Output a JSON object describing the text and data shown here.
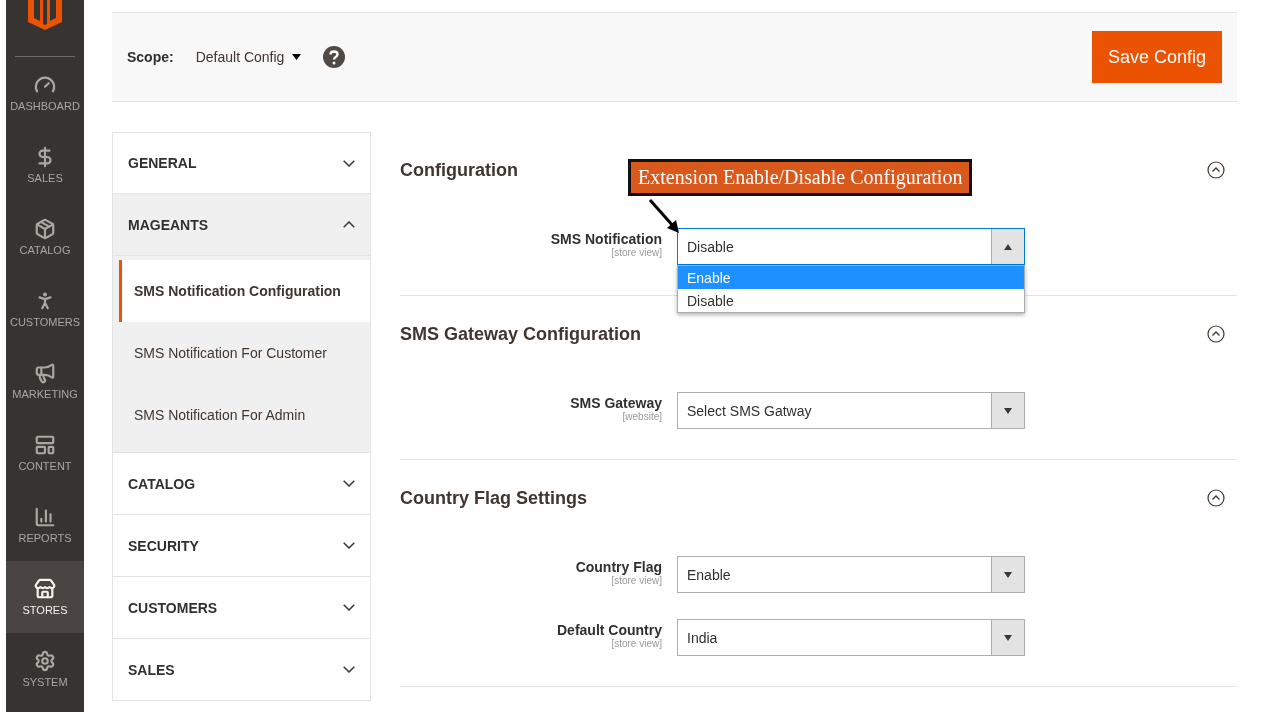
{
  "sidebar": {
    "items": [
      {
        "kind": "dashboard",
        "label": "DASHBOARD",
        "selected": false
      },
      {
        "kind": "sales",
        "label": "SALES",
        "selected": false
      },
      {
        "kind": "catalog",
        "label": "CATALOG",
        "selected": false
      },
      {
        "kind": "customers",
        "label": "CUSTOMERS",
        "selected": false
      },
      {
        "kind": "marketing",
        "label": "MARKETING",
        "selected": false
      },
      {
        "kind": "content",
        "label": "CONTENT",
        "selected": false
      },
      {
        "kind": "reports",
        "label": "REPORTS",
        "selected": false
      },
      {
        "kind": "stores",
        "label": "STORES",
        "selected": true
      },
      {
        "kind": "system",
        "label": "SYSTEM",
        "selected": false
      }
    ]
  },
  "header": {
    "scope_label": "Scope:",
    "scope_value": "Default Config",
    "save_button": "Save Config"
  },
  "nav": [
    {
      "label": "GENERAL",
      "expanded": false
    },
    {
      "label": "MAGEANTS",
      "expanded": true,
      "children": [
        {
          "label": "SMS Notification Configuration",
          "selected": true
        },
        {
          "label": "SMS Notification For Customer",
          "selected": false
        },
        {
          "label": "SMS Notification For Admin",
          "selected": false
        }
      ]
    },
    {
      "label": "CATALOG",
      "expanded": false
    },
    {
      "label": "SECURITY",
      "expanded": false
    },
    {
      "label": "CUSTOMERS",
      "expanded": false
    },
    {
      "label": "SALES",
      "expanded": false
    }
  ],
  "sections": [
    {
      "title": "Configuration",
      "expanded": true,
      "fields": [
        {
          "label": "SMS Notification",
          "scope": "[store view]",
          "value": "Disable",
          "open": true,
          "options": [
            {
              "label": "Enable",
              "highlighted": true
            },
            {
              "label": "Disable",
              "highlighted": false
            }
          ]
        }
      ]
    },
    {
      "title": "SMS Gateway Configuration",
      "expanded": true,
      "fields": [
        {
          "label": "SMS Gateway",
          "scope": "[website]",
          "value": "Select SMS Gatway",
          "open": false
        }
      ]
    },
    {
      "title": "Country Flag Settings",
      "expanded": true,
      "fields": [
        {
          "label": "Country Flag",
          "scope": "[store view]",
          "value": "Enable",
          "open": false
        },
        {
          "label": "Default Country",
          "scope": "[store view]",
          "value": "India",
          "open": false
        }
      ]
    }
  ],
  "annotation": {
    "text": "Extension Enable/Disable Configuration"
  }
}
